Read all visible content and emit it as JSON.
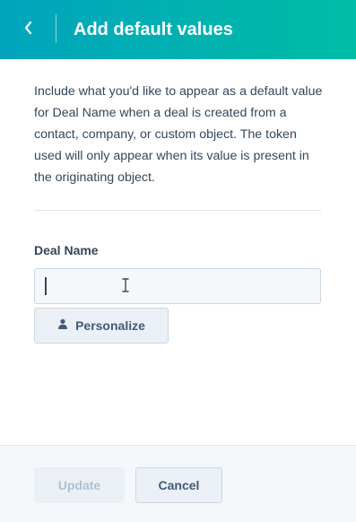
{
  "header": {
    "title": "Add default values",
    "back_icon": "chevron-left-icon",
    "gradient_start": "#00a4bd",
    "gradient_end": "#00bda5"
  },
  "description": "Include what you'd like to appear as a default value for Deal Name when a deal is created from a contact, company, or custom object. The token used will only appear when its value is present in the originating object.",
  "field": {
    "label": "Deal Name",
    "value": "",
    "placeholder": ""
  },
  "personalize": {
    "label": "Personalize",
    "icon": "person-icon"
  },
  "footer": {
    "update_label": "Update",
    "update_disabled": true,
    "cancel_label": "Cancel"
  },
  "colors": {
    "text": "#33475b",
    "button_text": "#425b76",
    "disabled_text": "#b0c1d4",
    "input_bg": "#f5f8fa",
    "border": "#cbd6e2"
  }
}
